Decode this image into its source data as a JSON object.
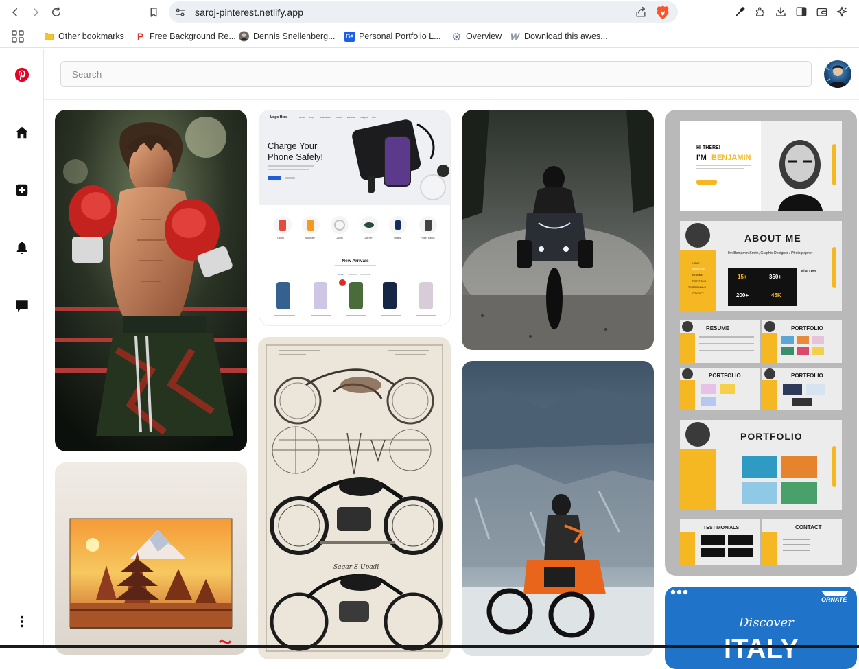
{
  "browser": {
    "url": "saroj-pinterest.netlify.app",
    "bookmarks": [
      {
        "label": "Other bookmarks",
        "icon": "folder-icon"
      },
      {
        "label": "Free Background Re...",
        "icon": "p-logo-icon"
      },
      {
        "label": "Dennis Snellenberg...",
        "icon": "profile-photo-icon"
      },
      {
        "label": "Personal Portfolio L...",
        "icon": "behance-icon"
      },
      {
        "label": "Overview",
        "icon": "gear-globe-icon"
      },
      {
        "label": "Download this awes...",
        "icon": "w-logo-icon"
      }
    ]
  },
  "app": {
    "search": {
      "placeholder": "Search",
      "value": ""
    },
    "sidebar": [
      "pinterest-logo-icon",
      "home-icon",
      "create-icon",
      "notifications-icon",
      "messages-icon",
      "more-icon"
    ]
  },
  "pins": {
    "phone": {
      "logo": "Logo Here",
      "nav": [
        "Home",
        "Shop",
        "Smartwatch",
        "Cables",
        "Earbuds",
        "Chargers",
        "Help"
      ],
      "heading_line1": "Charge Your",
      "heading_line2": "Phone Safely!",
      "categories": [
        "Cases",
        "MagSafe",
        "Cables",
        "Charger",
        "Straps",
        "Power Banks"
      ],
      "section_label": "New Arrivals",
      "tabs": [
        "CASES",
        "STRAPS",
        "MAGSAFE"
      ]
    },
    "sketch": {
      "signature": "Sagar S Upadi"
    },
    "portfolio": {
      "greeting": "HI THERE!",
      "intro": "I'M",
      "name": "BENJAMIN",
      "about_title": "ABOUT ME",
      "about_line": "I'm Benjamin Smith, Graphic Designer / Photographer",
      "stats": [
        "15+",
        "350+",
        "200+",
        "45K"
      ],
      "resume_title": "RESUME",
      "portfolio_title": "PORTFOLIO",
      "testimonials_title": "TESTIMONIALS",
      "contact_title": "CONTACT",
      "menu": [
        "HOME",
        "ABOUT ME",
        "RESUME",
        "PORTFOLIO",
        "TESTIMONIALS",
        "CONTACT"
      ],
      "what_i_do": "What I Do!"
    },
    "italy": {
      "brand": "ORNATE",
      "headline": "Discover",
      "country": "ITALY"
    }
  },
  "colors": {
    "pinterest_red": "#e60023",
    "portfolio_yellow": "#f5b822",
    "omnibox_bg": "#eceff4",
    "italy_blue": "#1f74c9"
  }
}
